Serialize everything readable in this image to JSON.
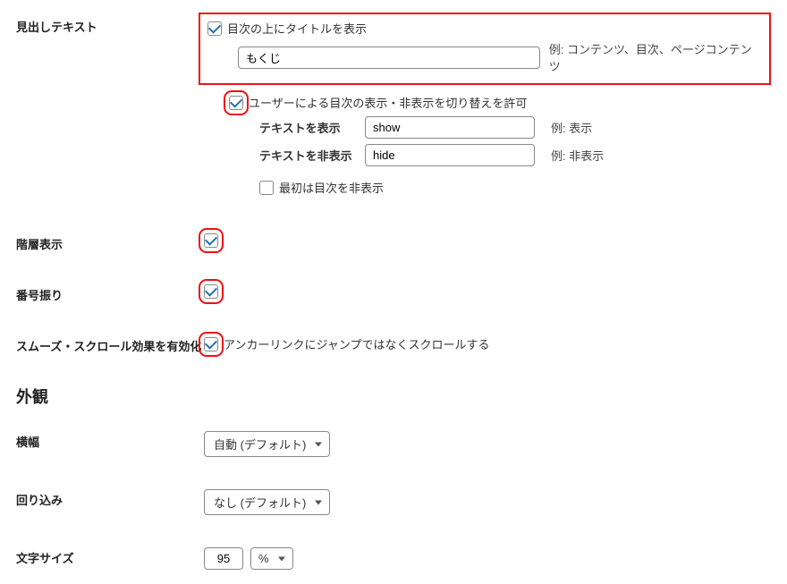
{
  "heading_text": {
    "row_label": "見出しテキスト",
    "show_title_label": "目次の上にタイトルを表示",
    "title_value": "もくじ",
    "title_hint": "例: コンテンツ、目次、ページコンテンツ",
    "toggle_label": "ユーザーによる目次の表示・非表示を切り替えを許可",
    "show_text_label": "テキストを表示",
    "show_text_value": "show",
    "show_text_hint": "例: 表示",
    "hide_text_label": "テキストを非表示",
    "hide_text_value": "hide",
    "hide_text_hint": "例: 非表示",
    "initial_hide_label": "最初は目次を非表示"
  },
  "hierarchy": {
    "row_label": "階層表示"
  },
  "numbering": {
    "row_label": "番号振り"
  },
  "smooth_scroll": {
    "row_label": "スムーズ・スクロール効果を有効化",
    "cb_label": "アンカーリンクにジャンプではなくスクロールする"
  },
  "appearance": {
    "title": "外観",
    "width_label": "横幅",
    "width_value": "自動 (デフォルト)",
    "wrap_label": "回り込み",
    "wrap_value": "なし (デフォルト)",
    "fontsize_label": "文字サイズ",
    "fontsize_value": "95",
    "fontsize_unit": "%"
  }
}
